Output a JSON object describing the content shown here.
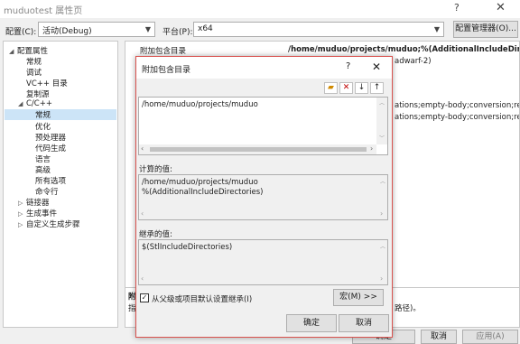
{
  "window": {
    "title": "muduotest 属性页",
    "help_glyph": "?",
    "close_glyph": "✕"
  },
  "toolbar": {
    "config_label": "配置(C):",
    "config_value": "活动(Debug)",
    "platform_label": "平台(P):",
    "platform_value": "x64",
    "config_manager_label": "配置管理器(O)..."
  },
  "tree": {
    "items": [
      {
        "label": "配置属性",
        "expander": "◢"
      },
      {
        "label": "常规"
      },
      {
        "label": "调试"
      },
      {
        "label": "VC++ 目录"
      },
      {
        "label": "复制源"
      },
      {
        "label": "C/C++",
        "expander": "◢"
      },
      {
        "label": "常规",
        "selected": true
      },
      {
        "label": "优化"
      },
      {
        "label": "预处理器"
      },
      {
        "label": "代码生成"
      },
      {
        "label": "语言"
      },
      {
        "label": "高级"
      },
      {
        "label": "所有选项"
      },
      {
        "label": "命令行"
      },
      {
        "label": "链接器",
        "expander": "▷"
      },
      {
        "label": "生成事件",
        "expander": "▷"
      },
      {
        "label": "自定义生成步骤",
        "expander": "▷"
      }
    ]
  },
  "grid": {
    "row1_name": "附加包含目录",
    "row1_value": "/home/muduo/projects/muduo;%(AdditionalIncludeDirectories",
    "row2_value_tail": "adwarf-2)",
    "row3_value_tail": "ations;empty-body;conversion;return",
    "row4_value_tail": "ations;empty-body;conversion;return",
    "desc_title_tail": "附",
    "desc_text_tail": "指",
    "desc_right_tail": "路径)。"
  },
  "footer": {
    "ok_tail": "确定",
    "cancel_label": "取消",
    "apply_label": "应用(A)"
  },
  "dialog": {
    "title": "附加包含目录",
    "help_glyph": "?",
    "close_glyph": "✕",
    "list_value": "/home/muduo/projects/muduo",
    "computed_label": "计算的值:",
    "computed_line1": "/home/muduo/projects/muduo",
    "computed_line2": "%(AdditionalIncludeDirectories)",
    "inherited_label": "继承的值:",
    "inherited_value": "$(StlIncludeDirectories)",
    "inherit_checkbox_label": "从父级或项目默认设置继承(I)",
    "inherit_checked": true,
    "macros_label": "宏(M) >>",
    "ok_label": "确定",
    "cancel_label": "取消"
  },
  "colors": {
    "selection": "#cce4f7",
    "dialog_border": "#d9534f",
    "window_bg": "#f0f0f0"
  }
}
